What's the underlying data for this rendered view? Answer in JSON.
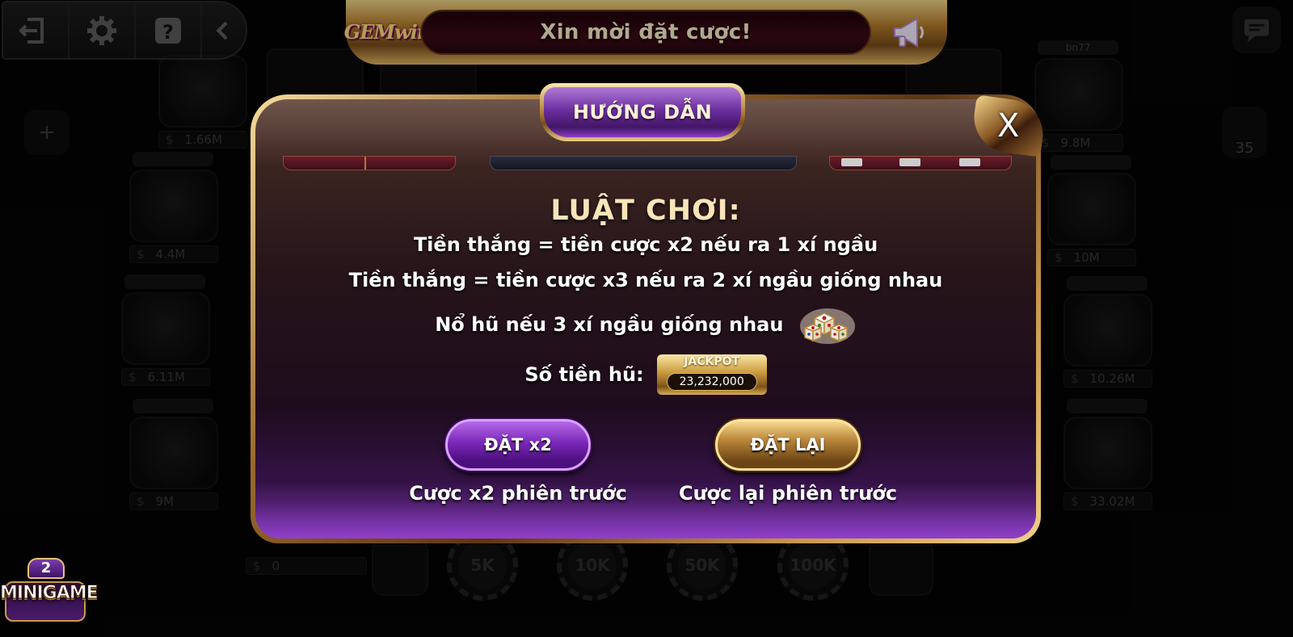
{
  "announcement": {
    "logo_text": "GEMwin",
    "message": "Xin mời đặt cược!"
  },
  "toolbar": {
    "items": [
      "exit-icon",
      "settings-icon",
      "help-icon",
      "collapse-icon"
    ]
  },
  "background": {
    "players": [
      {
        "name": "bn77",
        "money": "9.8M"
      },
      {
        "name": "",
        "money": "1.66M"
      },
      {
        "name": "",
        "money": "4.4M"
      },
      {
        "name": "",
        "money": "10M"
      },
      {
        "name": "",
        "money": "6.11M"
      },
      {
        "name": "",
        "money": "10.26M"
      },
      {
        "name": "",
        "money": "9M"
      },
      {
        "name": "",
        "money": "33.02M"
      },
      {
        "name": "",
        "money": "0"
      }
    ],
    "chips": [
      "5K",
      "10K",
      "50K",
      "100K"
    ],
    "online_count": "35"
  },
  "modal": {
    "title": "HƯỚNG DẪN",
    "close_label": "X",
    "rules_heading": "LUẬT CHƠI:",
    "rules": [
      "Tiền thắng = tiền cược x2 nếu ra 1 xí ngầu",
      "Tiền thắng = tiền cược x3 nếu ra 2 xí ngầu giống nhau",
      "Nổ hũ nếu 3 xí ngầu giống nhau"
    ],
    "jackpot": {
      "label": "Số tiền hũ:",
      "title": "JACKPOT",
      "value": "23,232,000"
    },
    "actions": [
      {
        "button": "ĐẶT x2",
        "description": "Cược x2 phiên trước"
      },
      {
        "button": "ĐẶT LẠI",
        "description": "Cược lại phiên trước"
      }
    ]
  },
  "minigame": {
    "badge": "2",
    "label": "MINIGAME"
  },
  "colors": {
    "gold": "#d9a84c",
    "purple": "#7a28b8",
    "modal_bg": "#26141a"
  }
}
